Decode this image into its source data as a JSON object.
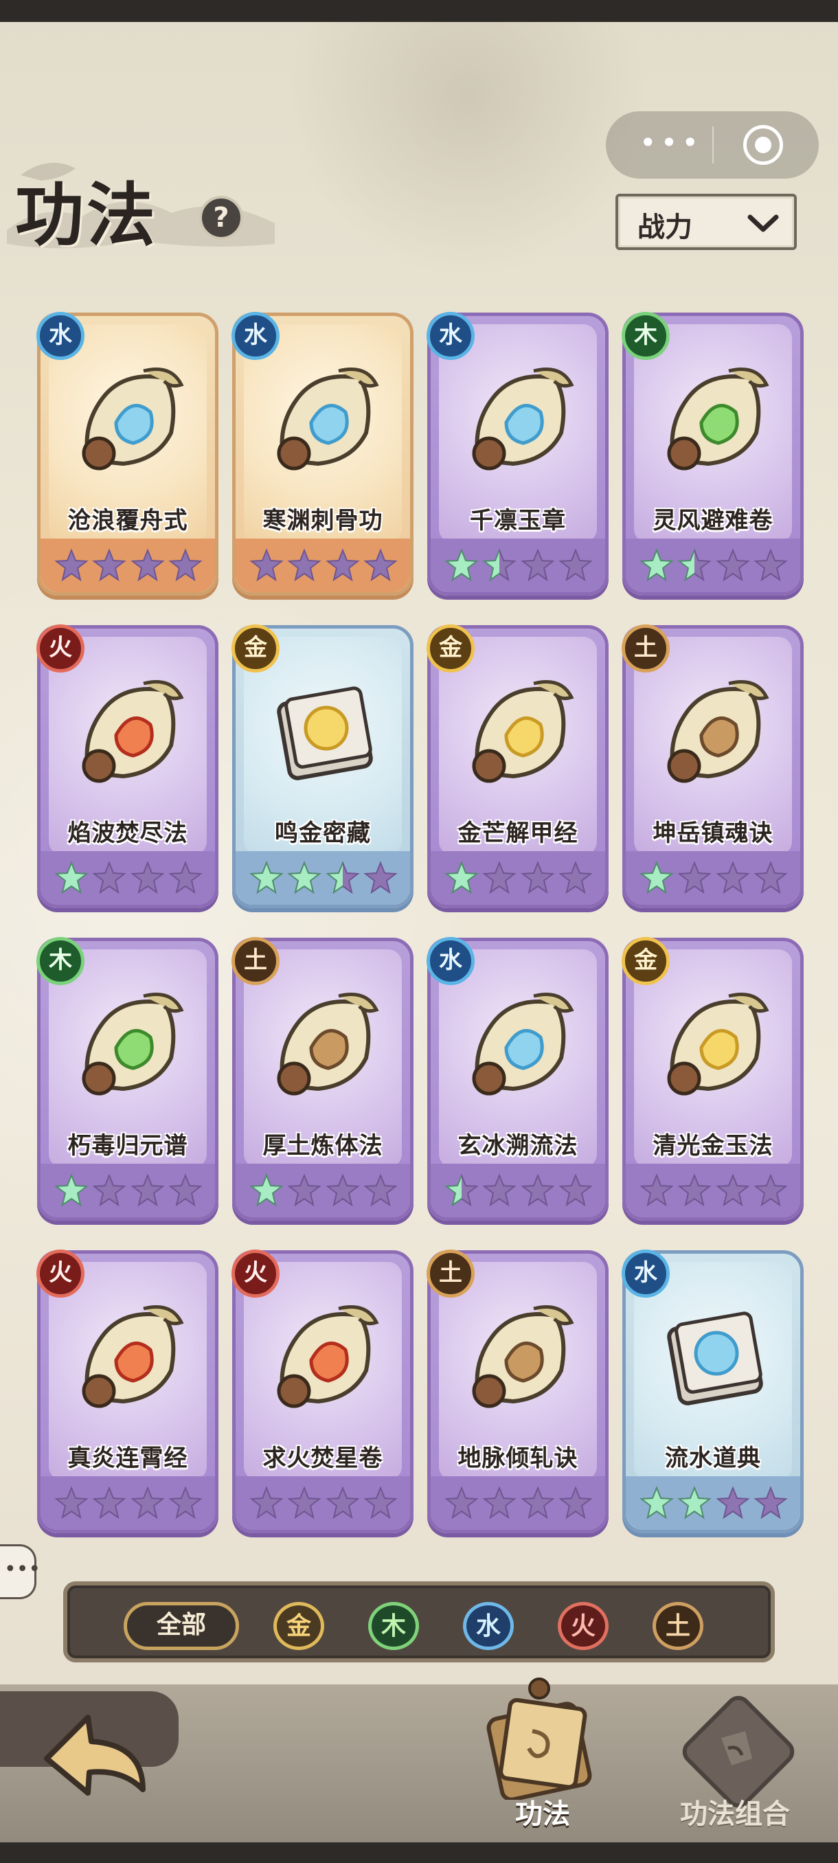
{
  "header": {
    "title": "功法",
    "help": "?",
    "sort_label": "战力",
    "capsule_more": "•••"
  },
  "colors": {
    "purple_card": "#a587d0",
    "orange_card": "#eec99a",
    "blue_card": "#b7d1e0",
    "star_lit": "#a8ecc4",
    "star_unlit": "#8f74b2"
  },
  "cards": [
    {
      "name": "沧浪覆舟式",
      "element": "水",
      "rarity": "orange",
      "icon": "ice-arrow-scroll-icon",
      "stars_lit": 0
    },
    {
      "name": "寒渊刺骨功",
      "element": "水",
      "rarity": "orange",
      "icon": "ice-crystal-scroll-icon",
      "stars_lit": 0
    },
    {
      "name": "千凛玉章",
      "element": "水",
      "rarity": "purple",
      "icon": "ice-shard-scroll-icon",
      "stars_lit": 1.5
    },
    {
      "name": "灵风避难卷",
      "element": "木",
      "rarity": "purple",
      "icon": "leaf-scroll-icon",
      "stars_lit": 1.5
    },
    {
      "name": "焰波焚尽法",
      "element": "火",
      "rarity": "purple",
      "icon": "flame-wave-scroll-icon",
      "stars_lit": 1
    },
    {
      "name": "鸣金密藏",
      "element": "金",
      "rarity": "blue",
      "icon": "golden-shield-book-icon",
      "stars_lit": 2.5
    },
    {
      "name": "金芒解甲经",
      "element": "金",
      "rarity": "purple",
      "icon": "golden-sword-scroll-icon",
      "stars_lit": 1
    },
    {
      "name": "坤岳镇魂诀",
      "element": "土",
      "rarity": "purple",
      "icon": "earth-rock-scroll-icon",
      "stars_lit": 1
    },
    {
      "name": "朽毒归元谱",
      "element": "木",
      "rarity": "purple",
      "icon": "poison-skull-scroll-icon",
      "stars_lit": 1
    },
    {
      "name": "厚土炼体法",
      "element": "土",
      "rarity": "purple",
      "icon": "earth-axe-scroll-icon",
      "stars_lit": 1
    },
    {
      "name": "玄冰溯流法",
      "element": "水",
      "rarity": "purple",
      "icon": "water-swirl-scroll-icon",
      "stars_lit": 0.5
    },
    {
      "name": "清光金玉法",
      "element": "金",
      "rarity": "purple",
      "icon": "golden-orb-scroll-icon",
      "stars_lit": 0
    },
    {
      "name": "真炎连霄经",
      "element": "火",
      "rarity": "purple",
      "icon": "fire-scroll-icon",
      "stars_lit": 0
    },
    {
      "name": "求火焚星卷",
      "element": "火",
      "rarity": "purple",
      "icon": "fire-figure-scroll-icon",
      "stars_lit": 0
    },
    {
      "name": "地脉倾轧诀",
      "element": "土",
      "rarity": "purple",
      "icon": "earth-mound-scroll-icon",
      "stars_lit": 0
    },
    {
      "name": "流水道典",
      "element": "水",
      "rarity": "blue",
      "icon": "water-wave-book-icon",
      "stars_lit": 2
    }
  ],
  "filters": {
    "all": "全部",
    "elements": [
      "金",
      "木",
      "水",
      "火",
      "土"
    ]
  },
  "nav": {
    "gongfa": "功法",
    "combo": "功法组合"
  }
}
